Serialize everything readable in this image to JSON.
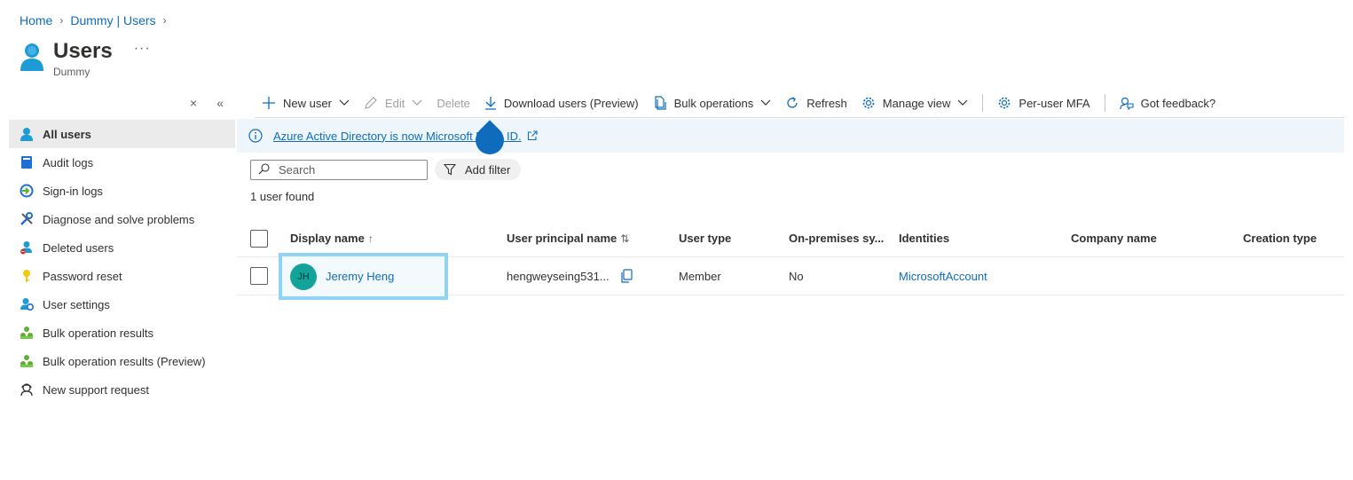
{
  "breadcrumb": [
    "Home",
    "Dummy | Users"
  ],
  "page": {
    "title": "Users",
    "subtitle": "Dummy",
    "more": "···"
  },
  "collapse": {
    "close": "×",
    "collapse": "«"
  },
  "sidebar": {
    "items": [
      {
        "label": "All users",
        "icon": "user-icon",
        "active": true
      },
      {
        "label": "Audit logs",
        "icon": "book-icon"
      },
      {
        "label": "Sign-in logs",
        "icon": "signin-icon"
      },
      {
        "label": "Diagnose and solve problems",
        "icon": "wrench-icon"
      },
      {
        "label": "Deleted users",
        "icon": "deleted-user-icon"
      },
      {
        "label": "Password reset",
        "icon": "key-icon"
      },
      {
        "label": "User settings",
        "icon": "user-settings-icon"
      },
      {
        "label": "Bulk operation results",
        "icon": "bulk-icon"
      },
      {
        "label": "Bulk operation results (Preview)",
        "icon": "bulk-icon"
      },
      {
        "label": "New support request",
        "icon": "support-icon"
      }
    ]
  },
  "toolbar": {
    "new_user": "New user",
    "edit": "Edit",
    "delete": "Delete",
    "download": "Download users (Preview)",
    "bulk": "Bulk operations",
    "refresh": "Refresh",
    "manage_view": "Manage view",
    "per_user_mfa": "Per-user MFA",
    "feedback": "Got feedback?"
  },
  "banner": {
    "text": "Azure Active Directory is now Microsoft Entra ID."
  },
  "search": {
    "placeholder": "Search"
  },
  "filter": {
    "label": "Add filter"
  },
  "count": "1 user found",
  "table": {
    "columns": {
      "display_name": "Display name",
      "upn": "User principal name",
      "user_type": "User type",
      "onprem": "On-premises sy...",
      "identities": "Identities",
      "company": "Company name",
      "creation": "Creation type"
    },
    "sort_display": "↑",
    "sort_upn": "⇅",
    "rows": [
      {
        "initials": "JH",
        "display_name": "Jeremy Heng",
        "upn": "hengweyseing531...",
        "user_type": "Member",
        "onprem": "No",
        "identities": "MicrosoftAccount",
        "company": "",
        "creation": ""
      }
    ]
  },
  "colors": {
    "accent": "#0f6cbd",
    "avatar": "#14a39a",
    "banner": "#eef6fc",
    "highlight": "#8fd3f7"
  }
}
